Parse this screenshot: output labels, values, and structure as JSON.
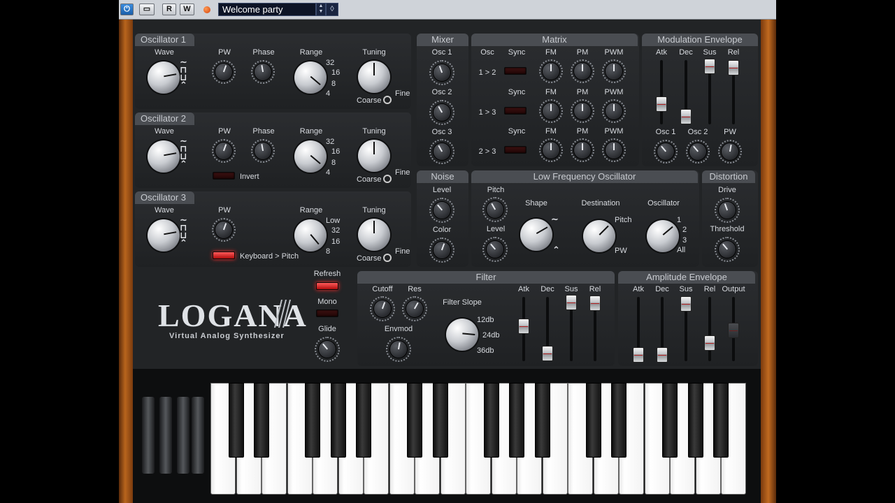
{
  "host_toolbar": {
    "power_icon": "power-icon",
    "monitor_icon": "monitor-icon",
    "read_label": "R",
    "write_label": "W",
    "record_icon": "record-dot-icon",
    "preset_name": "Welcome party",
    "preset_spin_icon": "up-down-arrows-icon",
    "preset_menu_icon": "diamond-menu-icon"
  },
  "oscillators": [
    {
      "title": "Oscillator 1",
      "wave": "Wave",
      "pw": "PW",
      "phase": "Phase",
      "range": "Range",
      "tuning": "Tuning",
      "range_marks": [
        "32",
        "16",
        "8",
        "4"
      ],
      "coarse": "Coarse",
      "fine": "Fine"
    },
    {
      "title": "Oscillator 2",
      "wave": "Wave",
      "pw": "PW",
      "phase": "Phase",
      "range": "Range",
      "tuning": "Tuning",
      "range_marks": [
        "32",
        "16",
        "8",
        "4"
      ],
      "coarse": "Coarse",
      "fine": "Fine",
      "extra_button": "Invert"
    },
    {
      "title": "Oscillator 3",
      "wave": "Wave",
      "pw": "PW",
      "range": "Range",
      "tuning": "Tuning",
      "range_marks": [
        "Low",
        "32",
        "16",
        "8"
      ],
      "coarse": "Coarse",
      "fine": "Fine",
      "extra_button": "Keyboard > Pitch"
    }
  ],
  "mixer": {
    "title": "Mixer",
    "knobs": [
      "Osc 1",
      "Osc 2",
      "Osc 3"
    ]
  },
  "matrix": {
    "title": "Matrix",
    "osc_header": "Osc",
    "rows": [
      {
        "route": "1 > 2",
        "sync": "Sync",
        "fm": "FM",
        "pm": "PM",
        "pwm": "PWM"
      },
      {
        "route": "1 > 3",
        "sync": "Sync",
        "fm": "FM",
        "pm": "PM",
        "pwm": "PWM"
      },
      {
        "route": "2 > 3",
        "sync": "Sync",
        "fm": "FM",
        "pm": "PM",
        "pwm": "PWM"
      }
    ]
  },
  "mod_envelope": {
    "title": "Modulation Envelope",
    "sliders": [
      "Atk",
      "Dec",
      "Sus",
      "Rel"
    ],
    "knobs": [
      "Osc 1",
      "Osc 2",
      "PW"
    ]
  },
  "noise": {
    "title": "Noise",
    "level": "Level",
    "color": "Color"
  },
  "lfo": {
    "title": "Low Frequency Oscillator",
    "pitch": "Pitch",
    "level": "Level",
    "shape": "Shape",
    "destination": "Destination",
    "dest_pitch": "Pitch",
    "dest_pw": "PW",
    "oscillator": "Oscillator",
    "osc_marks": [
      "1",
      "2",
      "3",
      "All"
    ]
  },
  "distortion": {
    "title": "Distortion",
    "drive": "Drive",
    "threshold": "Threshold"
  },
  "global": {
    "refresh": "Refresh",
    "mono": "Mono",
    "glide": "Glide"
  },
  "logo": {
    "name": "LOGANA",
    "subtitle": "Virtual Analog Synthesizer"
  },
  "filter": {
    "title": "Filter",
    "cutoff": "Cutoff",
    "res": "Res",
    "envmod": "Envmod",
    "slope_title": "Filter Slope",
    "slopes": [
      "12db",
      "24db",
      "36db"
    ],
    "sliders": [
      "Atk",
      "Dec",
      "Sus",
      "Rel"
    ]
  },
  "amp_envelope": {
    "title": "Amplitude Envelope",
    "sliders": [
      "Atk",
      "Dec",
      "Sus",
      "Rel",
      "Output"
    ]
  },
  "colors": {
    "led_on": "#ff2a2a",
    "panel": "#2b2d30",
    "wood": "#b8651d"
  }
}
